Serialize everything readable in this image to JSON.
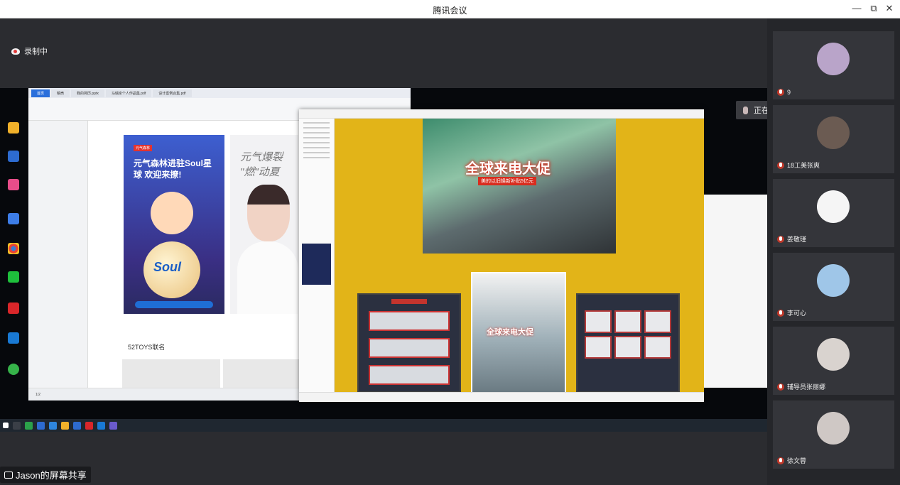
{
  "window": {
    "title": "腾讯会议",
    "min": "—",
    "restore": "⧉",
    "close": "✕"
  },
  "recording": {
    "label": "录制中"
  },
  "speaking": {
    "label": "正在讲话: Jason;"
  },
  "share": {
    "label": "Jason的屏幕共享"
  },
  "document": {
    "tabs": [
      "首页",
      "稿壳",
      "我的简历.pptx",
      "马瑞京个人作品集.pdf",
      "设计案例合集.pdf"
    ],
    "soul_brand": "元气森林",
    "soul_heading": "元气森林进驻Soul星球 欢迎来撩!",
    "soul_word": "Soul",
    "poster_title": "元气爆裂 \"燃\"动夏",
    "section_label": "52TOYS联名",
    "page_indicator": "1/2"
  },
  "viewer": {
    "hero_banner": "全球来电大促",
    "hero_sub": "美的以旧换新补贴5亿元",
    "mid_banner": "全球来电大促"
  },
  "participants": [
    {
      "name": "9",
      "avatar_color": "#b9a4c9"
    },
    {
      "name": "18工美张爽",
      "avatar_color": "#6b5b52"
    },
    {
      "name": "姜敬瑾",
      "avatar_color": "#f5f5f5"
    },
    {
      "name": "李可心",
      "avatar_color": "#9fc6e8"
    },
    {
      "name": "辅导员张丽娜",
      "avatar_color": "#d9d3cf"
    },
    {
      "name": "徐文蓉",
      "avatar_color": "#cfc8c5"
    }
  ]
}
